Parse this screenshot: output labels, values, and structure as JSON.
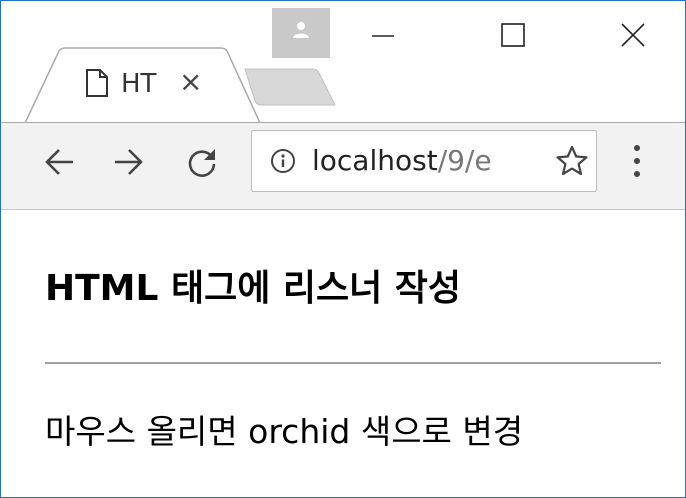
{
  "tab": {
    "title": "HT",
    "close_label": "×"
  },
  "address_bar": {
    "url_host": "localhost",
    "url_path": "/9/e"
  },
  "page": {
    "heading": "HTML 태그에 리스너 작성",
    "paragraph": "마우스 올리면 orchid 색으로 변경"
  },
  "icons": {
    "profile": "person-icon",
    "minimize": "minimize-icon",
    "maximize": "maximize-icon",
    "close": "close-icon",
    "favicon": "page-icon",
    "back": "arrow-left-icon",
    "forward": "arrow-right-icon",
    "reload": "reload-icon",
    "info": "info-icon",
    "bookmark": "star-icon",
    "menu": "kebab-menu-icon"
  },
  "colors": {
    "window_border": "#1f74c9",
    "toolbar_bg": "#f2f2f2",
    "profile_bg": "#c9c9c9"
  }
}
